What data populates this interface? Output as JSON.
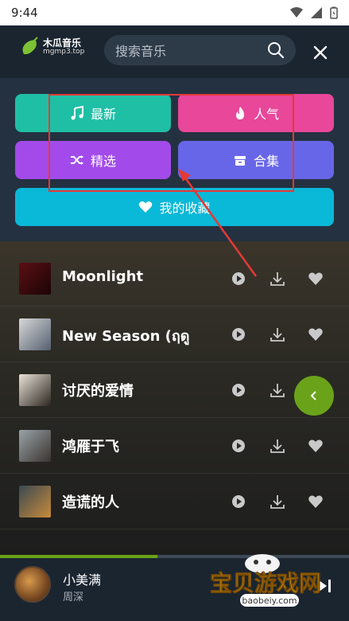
{
  "status_bar": {
    "time": "9:44"
  },
  "header": {
    "logo_name": "木瓜音乐",
    "logo_domain": "mgmp3.top",
    "search_placeholder": "搜索音乐"
  },
  "categories": [
    {
      "label": "最新",
      "icon": "music-note-icon",
      "color": "#1fbfa5"
    },
    {
      "label": "人气",
      "icon": "fire-icon",
      "color": "#e8479a"
    },
    {
      "label": "精选",
      "icon": "shuffle-icon",
      "color": "#a24bea"
    },
    {
      "label": "合集",
      "icon": "box-icon",
      "color": "#6866e8"
    },
    {
      "label": "我的收藏",
      "icon": "heart-icon",
      "color": "#0ab8d8"
    }
  ],
  "songs": [
    {
      "title": "Moonlight"
    },
    {
      "title": "New Season (ฤดูใบ"
    },
    {
      "title": "讨厌的爱情"
    },
    {
      "title": "鸿雁于飞"
    },
    {
      "title": "造谎的人"
    }
  ],
  "player": {
    "title": "小美满",
    "artist": "周深",
    "progress": 0.45
  },
  "watermark": {
    "text": "宝贝游戏网",
    "domain": "baobeiy.com"
  },
  "colors": {
    "accent_green": "#6aa31a",
    "highlight_red": "#e53935"
  }
}
